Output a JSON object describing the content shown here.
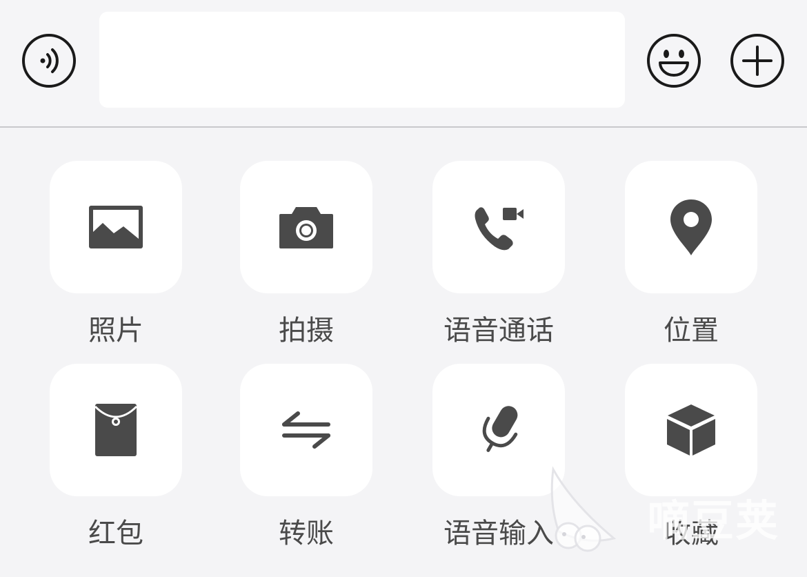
{
  "input_bar": {
    "voice_icon": "voice-wave-icon",
    "text_value": "",
    "emoji_icon": "smiley-icon",
    "plus_icon": "plus-circle-icon"
  },
  "panel": {
    "items": [
      {
        "label": "照片",
        "icon": "photo-icon"
      },
      {
        "label": "拍摄",
        "icon": "camera-icon"
      },
      {
        "label": "语音通话",
        "icon": "voice-call-icon"
      },
      {
        "label": "位置",
        "icon": "location-pin-icon"
      },
      {
        "label": "红包",
        "icon": "red-packet-icon"
      },
      {
        "label": "转账",
        "icon": "transfer-icon"
      },
      {
        "label": "语音输入",
        "icon": "microphone-icon"
      },
      {
        "label": "收藏",
        "icon": "cube-icon"
      }
    ]
  },
  "watermark": {
    "text": "嘀豆荚"
  },
  "colors": {
    "icon": "#4a4a4a",
    "background": "#f4f4f6",
    "tile": "#ffffff",
    "label": "#4a4a4a"
  }
}
